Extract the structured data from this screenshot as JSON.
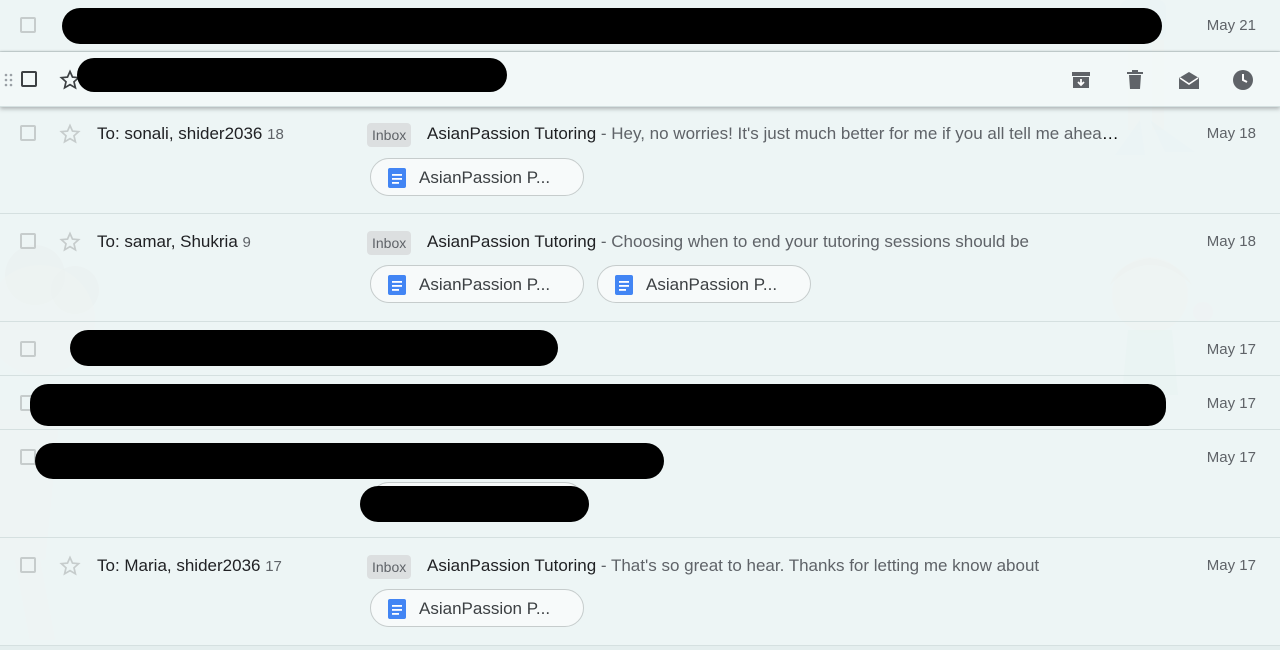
{
  "colors": {
    "background": "#e4eeee",
    "text": "#202124",
    "muted": "#5f6368",
    "doc_icon": "#4285f4",
    "redaction": "#000000"
  },
  "icons": {
    "star": "star-outline-icon",
    "drag": "drag-handle-icon",
    "archive": "archive-icon",
    "delete": "delete-icon",
    "mark_read": "mark-as-read-icon",
    "snooze": "snooze-icon",
    "attachment": "google-docs-icon"
  },
  "emails": [
    {
      "date": "May 21",
      "redacted": true
    },
    {
      "hovered": true,
      "redacted": true,
      "actions": [
        "Archive",
        "Delete",
        "Mark as read",
        "Snooze"
      ]
    },
    {
      "sender": "To: sonali, shider2036",
      "count": "18",
      "label": "Inbox",
      "subject": "AsianPassion Tutoring",
      "snippet": " - Hey, no worries! It's just much better for me if you all tell me ahead of time",
      "date": "May 18",
      "attachments": [
        "AsianPassion P..."
      ]
    },
    {
      "sender": "To: samar, Shukria",
      "count": "9",
      "label": "Inbox",
      "subject": "AsianPassion Tutoring",
      "snippet": " - Choosing when to end your tutoring sessions should be",
      "date": "May 18",
      "attachments": [
        "AsianPassion P...",
        "AsianPassion P..."
      ]
    },
    {
      "date": "May 17",
      "redacted": true
    },
    {
      "date": "May 17",
      "redacted": true
    },
    {
      "date": "May 17",
      "redacted": true
    },
    {
      "sender": "To: Maria, shider2036",
      "count": "17",
      "label": "Inbox",
      "subject": "AsianPassion Tutoring",
      "snippet": " - That's so great to hear. Thanks for letting me know about",
      "date": "May 17",
      "attachments": [
        "AsianPassion P..."
      ]
    }
  ]
}
